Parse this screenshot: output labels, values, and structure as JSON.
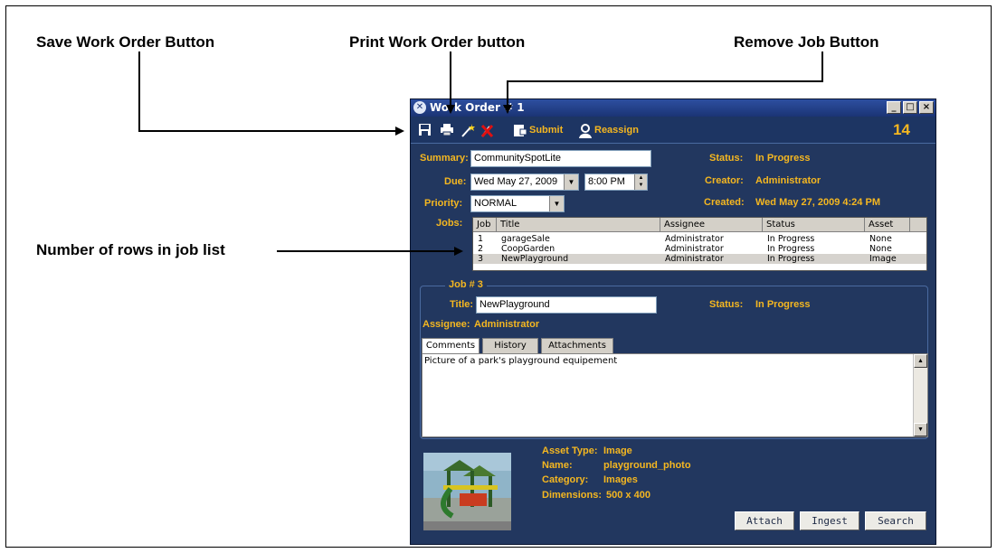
{
  "callouts": {
    "save": "Save Work Order Button",
    "print": "Print Work Order button",
    "remove": "Remove Job Button",
    "rows": "Number of rows in job list"
  },
  "window": {
    "title": "Work Order # 1",
    "controls": [
      "_",
      "□",
      "×"
    ]
  },
  "toolbar": {
    "submit_label": "Submit",
    "reassign_label": "Reassign",
    "count": "14"
  },
  "order": {
    "summary_label": "Summary:",
    "summary_value": "CommunitySpotLite",
    "due_label": "Due:",
    "due_date": "Wed May 27, 2009",
    "due_time": "8:00 PM",
    "priority_label": "Priority:",
    "priority_value": "NORMAL",
    "jobs_label": "Jobs:",
    "status_label": "Status:",
    "status_value": "In Progress",
    "creator_label": "Creator:",
    "creator_value": "Administrator",
    "created_label": "Created:",
    "created_value": "Wed May 27, 2009 4:24 PM"
  },
  "jobs_table": {
    "columns": [
      "Job",
      "Title",
      "Assignee",
      "Status",
      "Asset"
    ],
    "rows": [
      [
        "1",
        "garageSale",
        "Administrator",
        "In Progress",
        "None"
      ],
      [
        "2",
        "CoopGarden",
        "Administrator",
        "In Progress",
        "None"
      ],
      [
        "3",
        "NewPlayground",
        "Administrator",
        "In Progress",
        "Image"
      ]
    ]
  },
  "job": {
    "header": "Job # 3",
    "title_label": "Title:",
    "title_value": "NewPlayground",
    "status_label": "Status:",
    "status_value": "In Progress",
    "assignee_label": "Assignee:",
    "assignee_value": "Administrator",
    "tabs": [
      "Comments",
      "History",
      "Attachments"
    ],
    "comment": "Picture of a park's playground equipement"
  },
  "asset": {
    "type_label": "Asset Type:",
    "type_value": "Image",
    "name_label": "Name:",
    "name_value": "playground_photo",
    "category_label": "Category:",
    "category_value": "Images",
    "dimensions_label": "Dimensions:",
    "dimensions_value": "500 x 400"
  },
  "buttons": {
    "attach": "Attach",
    "ingest": "Ingest",
    "search": "Search"
  },
  "colors": {
    "window_bg": "#22375f",
    "accent_text": "#f5b720",
    "titlebar": "#1b3475"
  }
}
